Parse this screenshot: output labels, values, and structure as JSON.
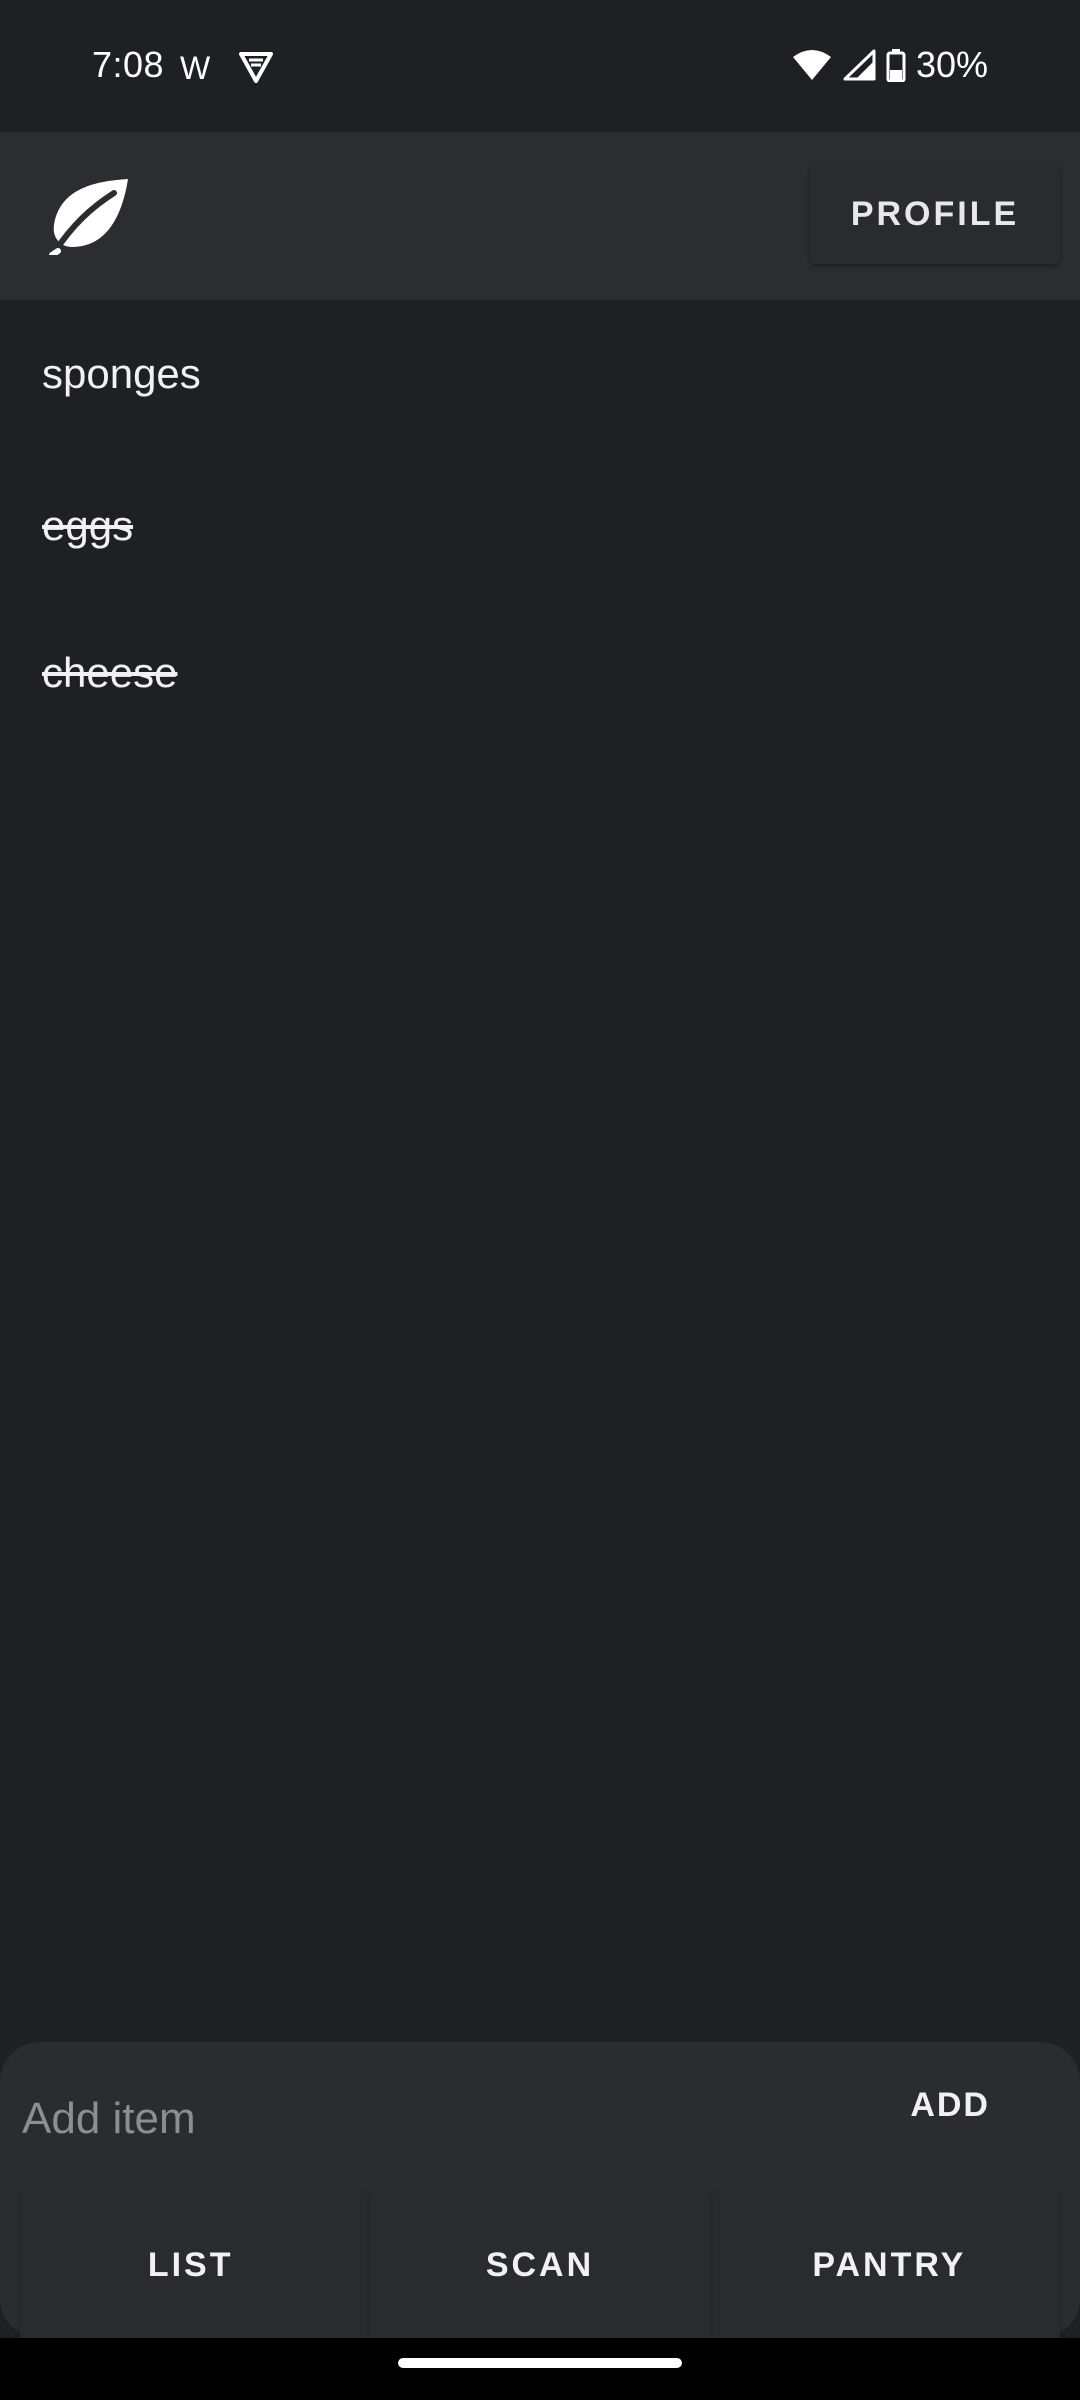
{
  "status_bar": {
    "time": "7:08",
    "notification_letter": "W",
    "battery": "30%",
    "icons": [
      "wifi-icon",
      "signal-icon",
      "battery-icon",
      "shield-icon"
    ]
  },
  "app_bar": {
    "logo": "leaf-icon",
    "profile_label": "PROFILE"
  },
  "items": [
    {
      "label": "sponges",
      "done": false
    },
    {
      "label": "eggs",
      "done": true
    },
    {
      "label": "cheese",
      "done": true
    }
  ],
  "add_bar": {
    "placeholder": "Add item",
    "value": "",
    "add_label": "ADD"
  },
  "tabs": [
    {
      "label": "LIST"
    },
    {
      "label": "SCAN"
    },
    {
      "label": "PANTRY"
    }
  ],
  "colors": {
    "background": "#1f2024",
    "app_bar": "#2c2d31",
    "panel": "#2b2c30"
  }
}
